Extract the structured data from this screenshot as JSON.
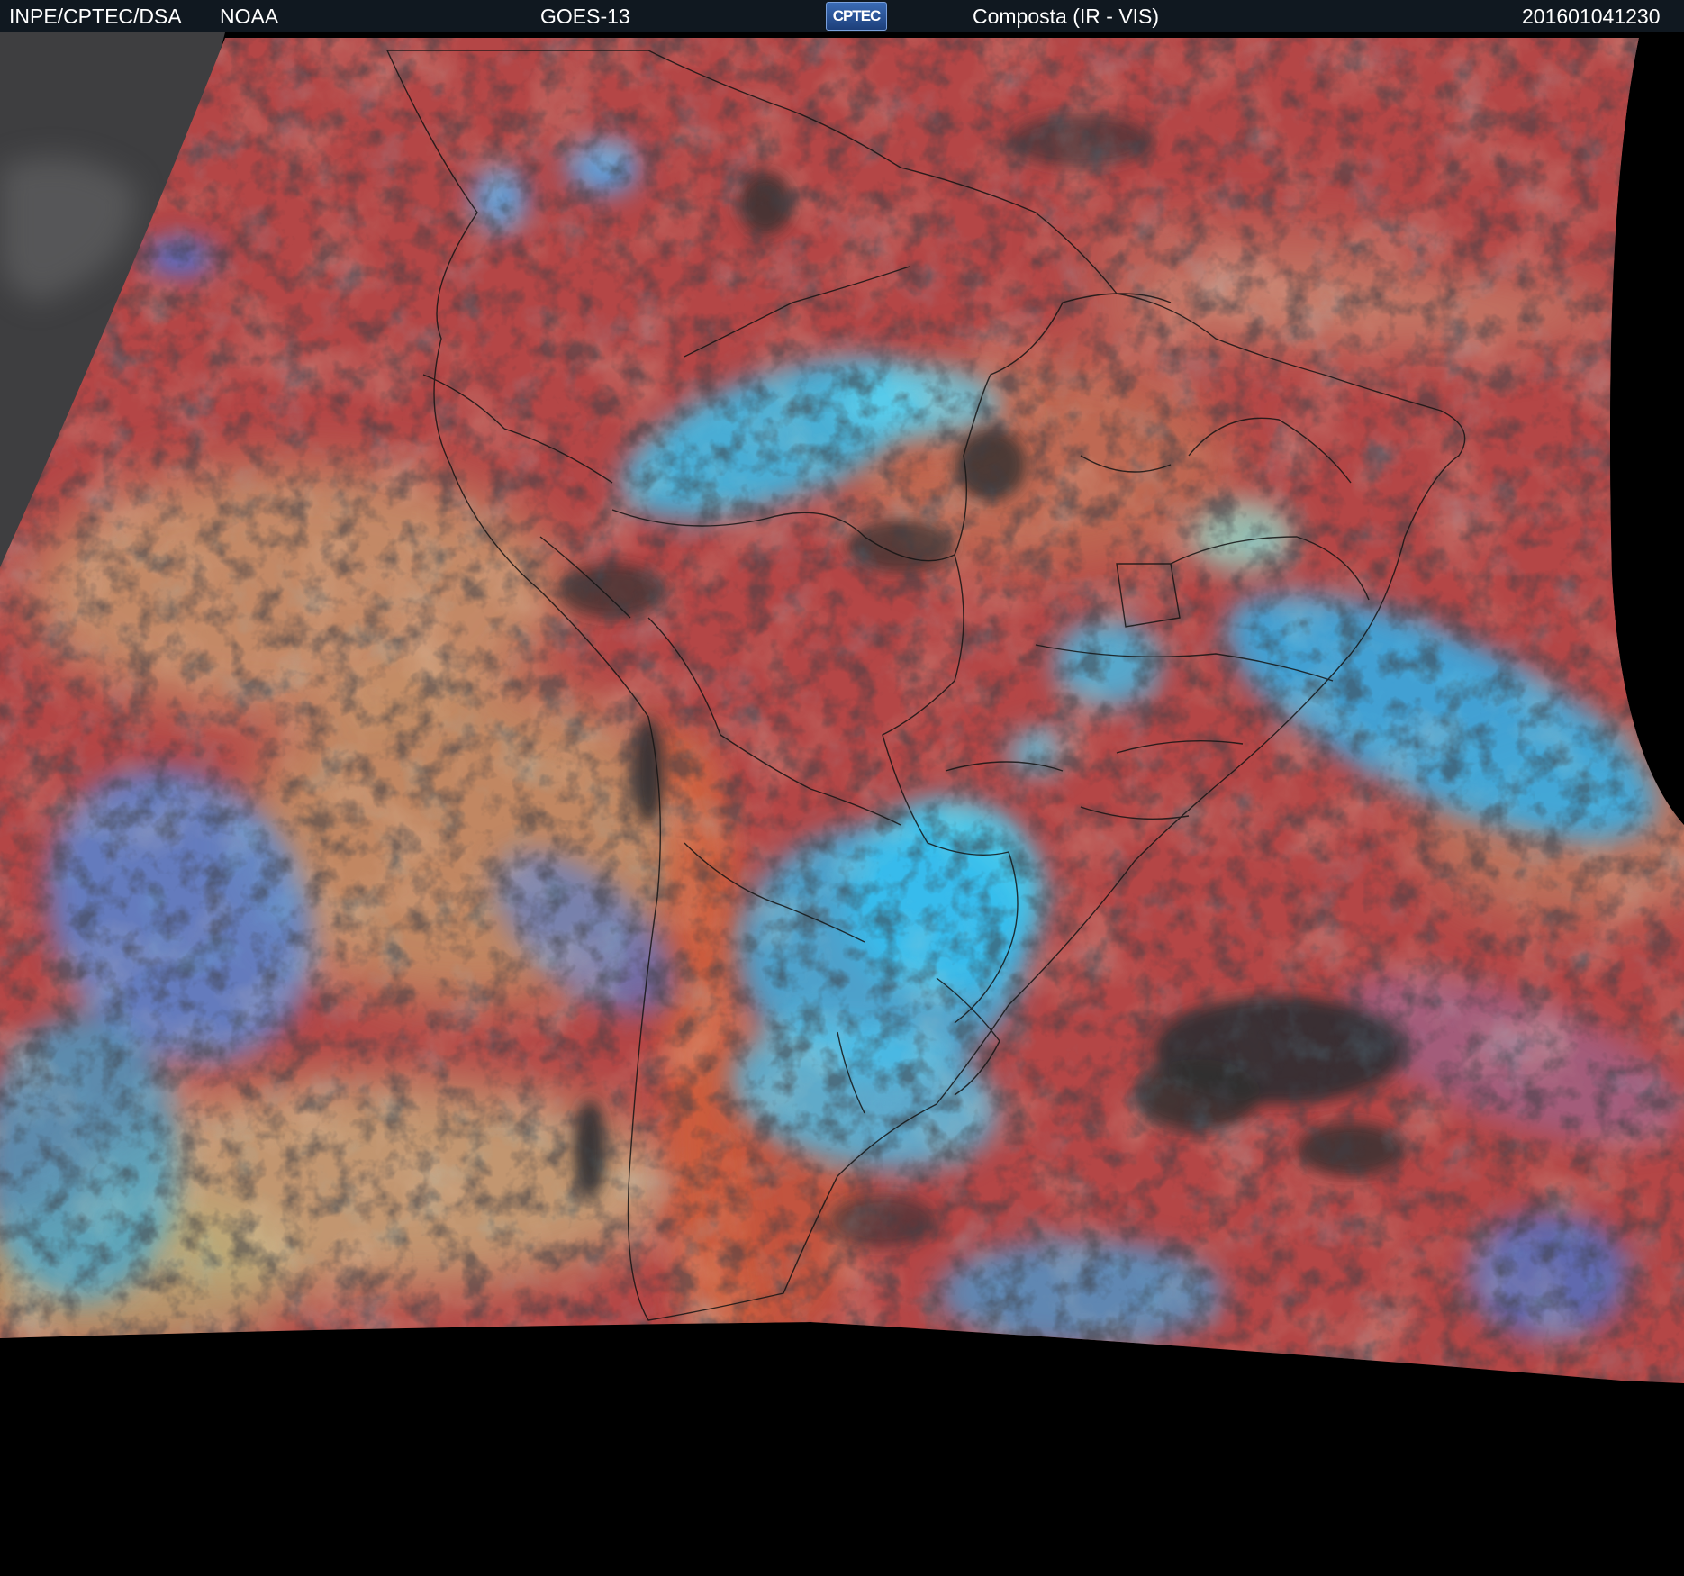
{
  "header": {
    "agency": "INPE/CPTEC/DSA",
    "partner": "NOAA",
    "satellite": "GOES-13",
    "logo_text": "CPTEC",
    "product": "Composta (IR - VIS)",
    "timestamp": "201601041230"
  },
  "image": {
    "subject": "satellite composite view of South America and surrounding oceans",
    "palette": {
      "header_bg": "#101820",
      "space": "#000000",
      "ir_ocean": "#b84444",
      "warm_land": "#c0503a",
      "low_cloud_yellow": "#c8b070",
      "high_cloud_cyan": "#35c8f0",
      "cold_cloud_blue": "#3a78e0",
      "clear_dark": "#2e2e30",
      "vis_only_gray": "#555555",
      "borders": "#101010"
    }
  }
}
